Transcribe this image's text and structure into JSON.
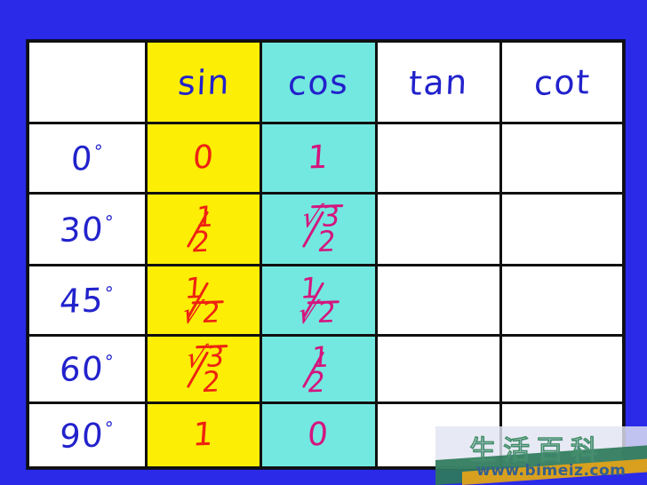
{
  "background_color": "#2a2ae8",
  "table": {
    "name": "trigonometric-values-table",
    "columns": [
      {
        "key": "angle",
        "label": "",
        "fill": "#ffffff",
        "ink": "#2222cc"
      },
      {
        "key": "sin",
        "label": "sin",
        "fill": "#fcee05",
        "ink": "#ee2211"
      },
      {
        "key": "cos",
        "label": "cos",
        "fill": "#73e8e0",
        "ink": "#d4157e"
      },
      {
        "key": "tan",
        "label": "tan",
        "fill": "#ffffff",
        "ink": ""
      },
      {
        "key": "cot",
        "label": "cot",
        "fill": "#ffffff",
        "ink": ""
      }
    ],
    "header_ink": "#2222cc",
    "rows": [
      {
        "angle": "0",
        "degree_symbol": "°",
        "sin": "0",
        "cos": "1",
        "tan": "",
        "cot": ""
      },
      {
        "angle": "30",
        "degree_symbol": "°",
        "sin": "1/2",
        "cos": "√3/2",
        "tan": "",
        "cot": ""
      },
      {
        "angle": "45",
        "degree_symbol": "°",
        "sin": "1/√2",
        "cos": "1/√2",
        "tan": "",
        "cot": ""
      },
      {
        "angle": "60",
        "degree_symbol": "°",
        "sin": "√3/2",
        "cos": "1/2",
        "tan": "",
        "cot": ""
      },
      {
        "angle": "90",
        "degree_symbol": "°",
        "sin": "1",
        "cos": "0",
        "tan": "",
        "cot": ""
      }
    ],
    "fraction_parts": {
      "r30_sin_num": "1",
      "r30_sin_den": "2",
      "r30_cos_num_radicand": "3",
      "r30_cos_den": "2",
      "r45_sin_num": "1",
      "r45_sin_den_radicand": "2",
      "r45_cos_num": "1",
      "r45_cos_den_radicand": "2",
      "r60_sin_num_radicand": "3",
      "r60_sin_den": "2",
      "r60_cos_num": "1",
      "r60_cos_den": "2",
      "radical_glyph": "√"
    }
  },
  "watermark": {
    "chinese_text": "生活百科",
    "url": "www.bimeiz.com",
    "stroke_color": "#3f8f63",
    "url_color": "#34608f"
  }
}
